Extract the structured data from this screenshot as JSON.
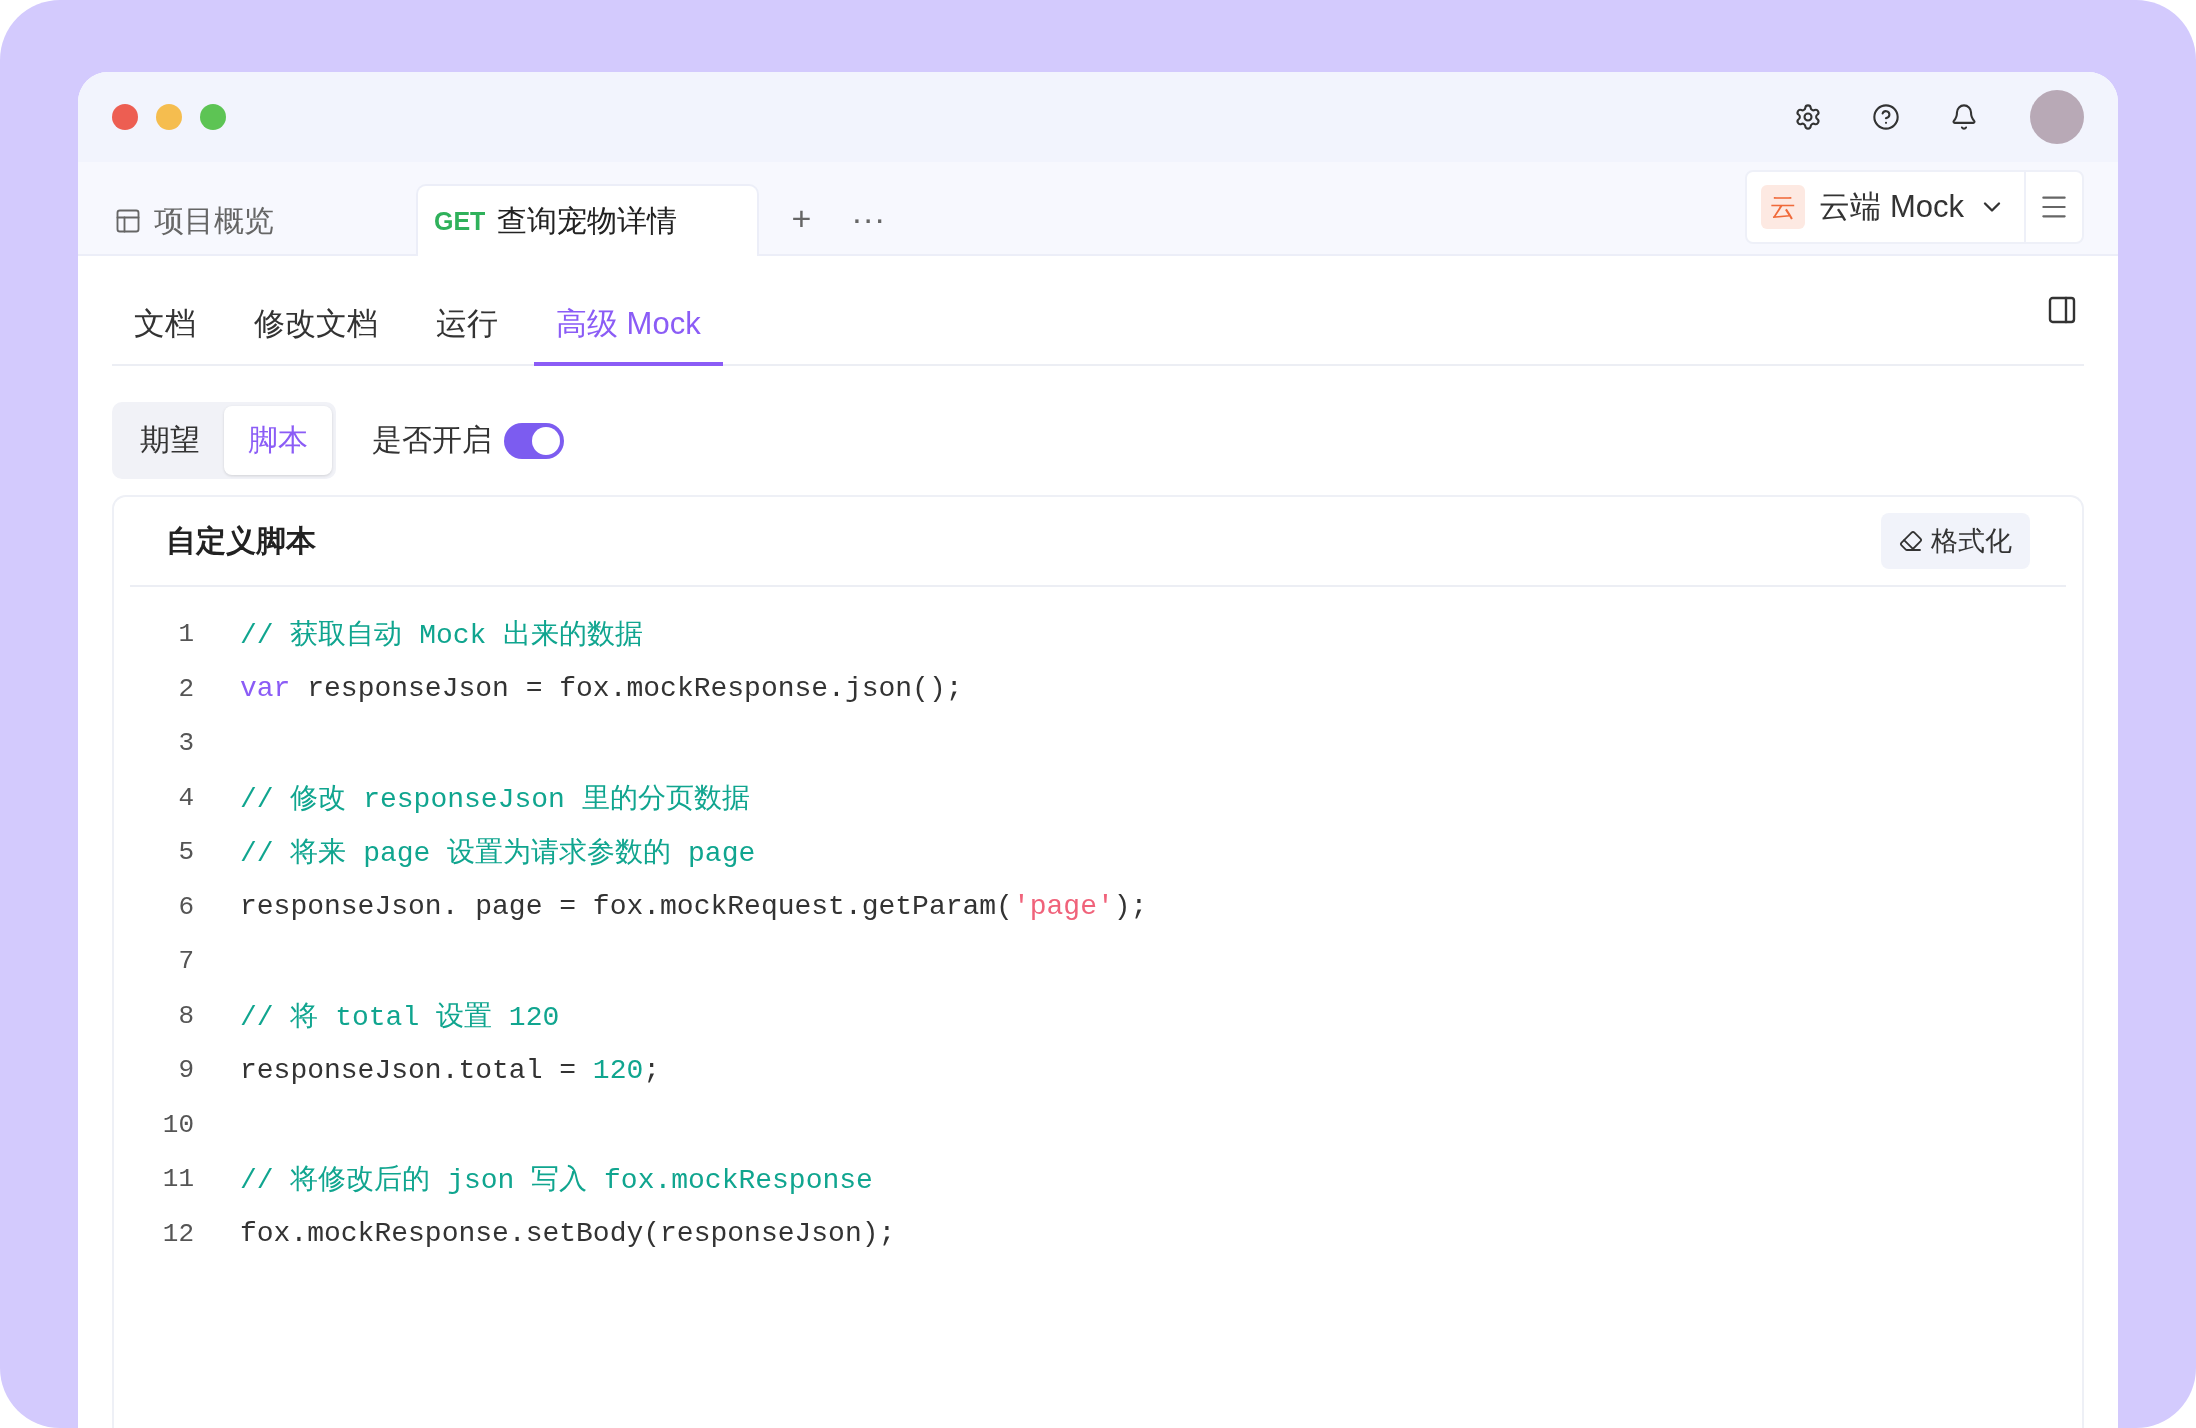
{
  "title_bar": {
    "actions": [
      {
        "kind": "settings"
      },
      {
        "kind": "help"
      },
      {
        "kind": "notifications"
      }
    ]
  },
  "tabs": [
    {
      "kind": "overview",
      "label": "项目概览",
      "selected": false
    },
    {
      "kind": "api",
      "method": "GET",
      "label": "查询宠物详情",
      "selected": true
    }
  ],
  "tab_actions": {
    "add": "+",
    "more": "···"
  },
  "env_selector": {
    "badge": "云",
    "label": "云端 Mock"
  },
  "sub_tabs": [
    {
      "label": "文档",
      "selected": false
    },
    {
      "label": "修改文档",
      "selected": false
    },
    {
      "label": "运行",
      "selected": false
    },
    {
      "label": "高级 Mock",
      "selected": true
    }
  ],
  "mode_switch": [
    {
      "label": "期望",
      "selected": false
    },
    {
      "label": "脚本",
      "selected": true
    }
  ],
  "enable_toggle": {
    "label": "是否开启",
    "on": true
  },
  "script_card": {
    "title": "自定义脚本",
    "format_button": "格式化",
    "lines": [
      {
        "number": "1",
        "tokens": [
          {
            "kind": "comment",
            "text": "// 获取自动 Mock 出来的数据"
          }
        ]
      },
      {
        "number": "2",
        "tokens": [
          {
            "kind": "keyword",
            "text": "var"
          },
          {
            "kind": "plain",
            "text": " responseJson = fox.mockResponse.json();"
          }
        ]
      },
      {
        "number": "3"
      },
      {
        "number": "4",
        "tokens": [
          {
            "kind": "comment",
            "text": "// 修改 responseJson 里的分页数据"
          }
        ]
      },
      {
        "number": "5",
        "tokens": [
          {
            "kind": "comment",
            "text": "// 将来 page 设置为请求参数的 page"
          }
        ]
      },
      {
        "number": "6",
        "tokens": [
          {
            "kind": "plain",
            "text": "responseJson. page = fox.mockRequest.getParam("
          },
          {
            "kind": "string",
            "text": "'page'"
          },
          {
            "kind": "plain",
            "text": ");"
          }
        ]
      },
      {
        "number": "7"
      },
      {
        "number": "8",
        "tokens": [
          {
            "kind": "comment",
            "text": "// 将 total 设置 120"
          }
        ]
      },
      {
        "number": "9",
        "tokens": [
          {
            "kind": "plain",
            "text": "responseJson.total = "
          },
          {
            "kind": "number",
            "text": "120"
          },
          {
            "kind": "plain",
            "text": ";"
          }
        ]
      },
      {
        "number": "10"
      },
      {
        "number": "11",
        "tokens": [
          {
            "kind": "comment",
            "text": "// 将修改后的 json 写入 fox.mockResponse"
          }
        ]
      },
      {
        "number": "12",
        "tokens": [
          {
            "kind": "plain",
            "text": "fox.mockResponse.setBody(responseJson);"
          }
        ]
      }
    ]
  }
}
